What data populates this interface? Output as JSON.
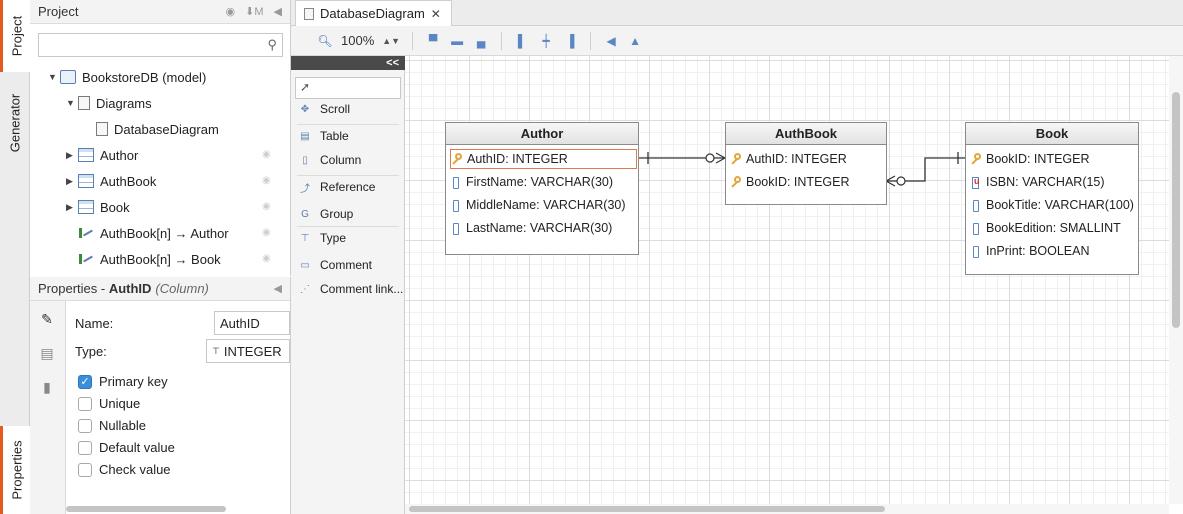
{
  "side_tabs": {
    "project": "Project",
    "generator": "Generator",
    "properties": "Properties"
  },
  "project": {
    "title": "Project",
    "search_placeholder": "",
    "tree": [
      {
        "label": "BookstoreDB (model)",
        "icon": "model-icon",
        "expanded": true
      },
      {
        "label": "Diagrams",
        "icon": "diagrams-icon",
        "expanded": true
      },
      {
        "label": "DatabaseDiagram",
        "icon": "diagram-icon"
      },
      {
        "label": "Author",
        "icon": "table-icon",
        "expanded": false
      },
      {
        "label": "AuthBook",
        "icon": "table-icon",
        "expanded": false
      },
      {
        "label": "Book",
        "icon": "table-icon",
        "expanded": false
      },
      {
        "label": "AuthBook[n] → Author",
        "icon": "reference-icon"
      },
      {
        "label": "AuthBook[n] → Book",
        "icon": "reference-icon"
      }
    ]
  },
  "properties": {
    "title_prefix": "Properties - ",
    "title_object": "AuthID",
    "title_kind": "(Column)",
    "name_label": "Name:",
    "name_value": "AuthID",
    "type_label": "Type:",
    "type_value": "INTEGER",
    "checkboxes": [
      {
        "label": "Primary key",
        "checked": true
      },
      {
        "label": "Unique",
        "checked": false
      },
      {
        "label": "Nullable",
        "checked": false
      },
      {
        "label": "Default value",
        "checked": false
      },
      {
        "label": "Check value",
        "checked": false
      }
    ]
  },
  "editor": {
    "tab_label": "DatabaseDiagram",
    "zoom": "100%"
  },
  "palette": {
    "collapse_label": "<<",
    "items": [
      {
        "label": "Scroll",
        "icon": "scroll-icon"
      },
      {
        "label": "Table",
        "icon": "table-icon"
      },
      {
        "label": "Column",
        "icon": "column-icon"
      },
      {
        "label": "Reference",
        "icon": "reference-icon"
      },
      {
        "label": "Group",
        "icon": "group-icon"
      },
      {
        "label": "Type",
        "icon": "type-icon"
      },
      {
        "label": "Comment",
        "icon": "comment-icon"
      },
      {
        "label": "Comment link...",
        "icon": "comment-link-icon"
      }
    ]
  },
  "diagram": {
    "entities": [
      {
        "name": "Author",
        "columns": [
          {
            "text": "AuthID: INTEGER",
            "kind": "key",
            "selected": true
          },
          {
            "text": "FirstName: VARCHAR(30)",
            "kind": "col"
          },
          {
            "text": "MiddleName: VARCHAR(30)",
            "kind": "col"
          },
          {
            "text": "LastName: VARCHAR(30)",
            "kind": "col"
          }
        ]
      },
      {
        "name": "AuthBook",
        "columns": [
          {
            "text": "AuthID: INTEGER",
            "kind": "key"
          },
          {
            "text": "BookID: INTEGER",
            "kind": "key"
          }
        ]
      },
      {
        "name": "Book",
        "columns": [
          {
            "text": "BookID: INTEGER",
            "kind": "key"
          },
          {
            "text": "ISBN: VARCHAR(15)",
            "kind": "unique"
          },
          {
            "text": "BookTitle: VARCHAR(100)",
            "kind": "col"
          },
          {
            "text": "BookEdition: SMALLINT",
            "kind": "col"
          },
          {
            "text": "InPrint: BOOLEAN",
            "kind": "col"
          }
        ]
      }
    ]
  },
  "colors": {
    "accent": "#e45a1f",
    "check": "#3b8fd8",
    "key": "#e0a63a"
  }
}
